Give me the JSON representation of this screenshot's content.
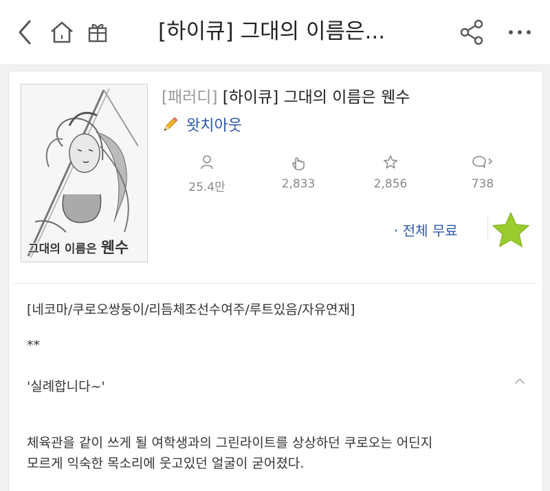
{
  "header": {
    "title": "[하이큐] 그대의 이름은...",
    "icons": [
      "back-icon",
      "home-icon",
      "gift-icon",
      "share-icon",
      "more-icon"
    ]
  },
  "work": {
    "cover_title_main": "그대의 이름은",
    "cover_title_big": "웬수",
    "tag": "[패러디]",
    "title": "[하이큐] 그대의 이름은 웬수",
    "author": "왓치아웃"
  },
  "stats": [
    {
      "icon": "person-icon",
      "value": "25.4만"
    },
    {
      "icon": "hand-like-icon",
      "value": "2,833"
    },
    {
      "icon": "star-outline-icon",
      "value": "2,856"
    },
    {
      "icon": "comment-icon",
      "value": "738"
    }
  ],
  "pricing": {
    "label": "· 전체 무료"
  },
  "description": {
    "tags": "[네코마/쿠로오쌍둥이/리듬체조선수여주/루트있음/자유연재]",
    "line1": "**",
    "line2": "'실례합니다~'",
    "line3": "체육관을 같이 쓰게 될 여학생과의 그린라이트를 상상하던 쿠로오는 어딘지",
    "line4": "모르게 익숙한 목소리에 웃고있던 얼굴이 굳어졌다."
  },
  "colors": {
    "accent": "#2b56a8",
    "favorite_star": "#9bcc2e",
    "muted": "#888888"
  }
}
